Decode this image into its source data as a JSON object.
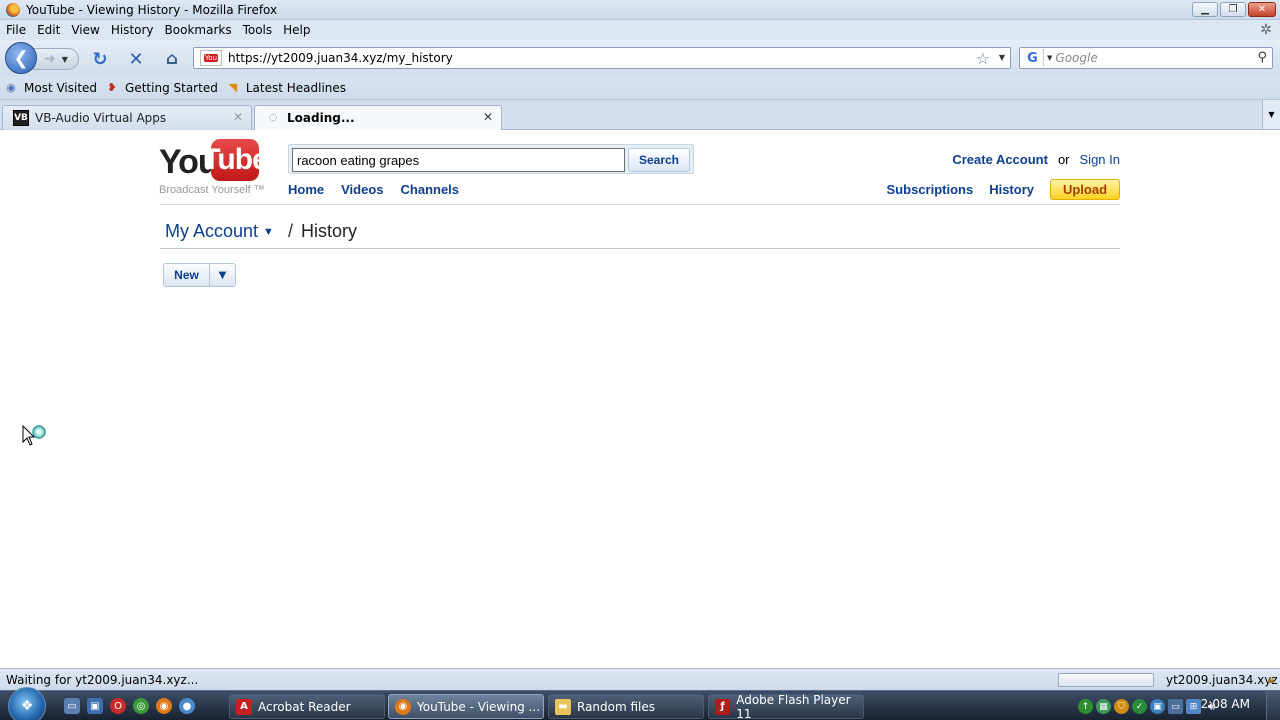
{
  "window": {
    "title": "YouTube - Viewing History - Mozilla Firefox",
    "minimize": "▁",
    "maximize": "❐",
    "close": "✕"
  },
  "menubar": [
    "File",
    "Edit",
    "View",
    "History",
    "Bookmarks",
    "Tools",
    "Help"
  ],
  "navbar": {
    "url": "https://yt2009.juan34.xyz/my_history",
    "site_icon_text": "You",
    "search_placeholder": "Google",
    "search_engine_letter": "G"
  },
  "bookmarks": [
    {
      "label": "Most Visited",
      "icon": "globe-icon"
    },
    {
      "label": "Getting Started",
      "icon": "firefox-icon"
    },
    {
      "label": "Latest Headlines",
      "icon": "rss-icon"
    }
  ],
  "tabs": [
    {
      "label": "VB-Audio Virtual Apps",
      "icon_text": "VB",
      "active": false
    },
    {
      "label": "Loading...",
      "icon_text": "◌",
      "active": true
    }
  ],
  "page": {
    "logo_you": "You",
    "logo_tube": "Tube",
    "logo_tagline": "Broadcast Yourself ™",
    "search_value": "racoon eating grapes",
    "search_button": "Search",
    "nav": [
      "Home",
      "Videos",
      "Channels"
    ],
    "create_account": "Create Account",
    "or": "or",
    "sign_in": "Sign In",
    "subscriptions": "Subscriptions",
    "history": "History",
    "upload": "Upload",
    "breadcrumb_account": "My Account",
    "breadcrumb_sep": "/",
    "breadcrumb_current": "History",
    "new_button": "New"
  },
  "status": {
    "text": "Waiting for yt2009.juan34.xyz...",
    "host": "yt2009.juan34.xyz",
    "progress": 0
  },
  "taskbar": {
    "tasks": [
      {
        "label": "Acrobat Reader",
        "icon": "acrobat-icon",
        "active": false
      },
      {
        "label": "YouTube - Viewing ...",
        "icon": "firefox-icon",
        "active": true
      },
      {
        "label": "Random files",
        "icon": "folder-icon",
        "active": false
      },
      {
        "label": "Adobe Flash Player 11",
        "icon": "flash-icon",
        "active": false
      }
    ],
    "clock": "2:08 AM"
  }
}
